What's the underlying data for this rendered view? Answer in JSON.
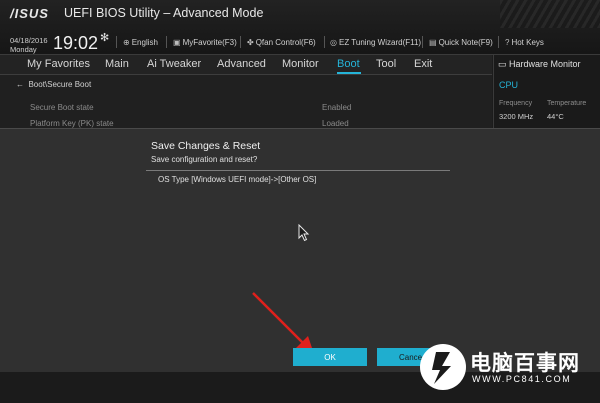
{
  "header": {
    "logo": "/ISUS",
    "title": "UEFI BIOS Utility – Advanced Mode",
    "date": "04/18/2016",
    "weekday": "Monday",
    "time": "19:02",
    "tools": [
      {
        "icon": "globe-icon",
        "label": "English"
      },
      {
        "icon": "favorite-icon",
        "label": "MyFavorite(F3)"
      },
      {
        "icon": "fan-icon",
        "label": "Qfan Control(F6)"
      },
      {
        "icon": "wizard-icon",
        "label": "EZ Tuning Wizard(F11)"
      },
      {
        "icon": "note-icon",
        "label": "Quick Note(F9)"
      },
      {
        "icon": "hotkeys-icon",
        "label": "Hot Keys"
      }
    ]
  },
  "menu": {
    "items": [
      "My Favorites",
      "Main",
      "Ai Tweaker",
      "Advanced",
      "Monitor",
      "Boot",
      "Tool",
      "Exit"
    ],
    "active": "Boot"
  },
  "breadcrumb": "Boot\\Secure Boot",
  "settings": [
    {
      "label": "Secure Boot state",
      "value": "Enabled"
    },
    {
      "label": "Platform Key (PK) state",
      "value": "Loaded"
    }
  ],
  "hardware_monitor": {
    "title": "Hardware Monitor",
    "section": "CPU",
    "frequency_label": "Frequency",
    "frequency_value": "3200 MHz",
    "temperature_label": "Temperature",
    "temperature_value": "44°C"
  },
  "dialog": {
    "title": "Save Changes & Reset",
    "subtitle": "Save configuration and reset?",
    "changes": [
      "OS Type [Windows UEFI mode]->[Other OS]"
    ],
    "ok_label": "OK",
    "cancel_label": "Cance"
  },
  "watermark": {
    "name": "电脑百事网",
    "url": "WWW.PC841.COM"
  },
  "colors": {
    "accent": "#25b4d8",
    "button": "#1faecf",
    "arrow": "#e0201c"
  }
}
